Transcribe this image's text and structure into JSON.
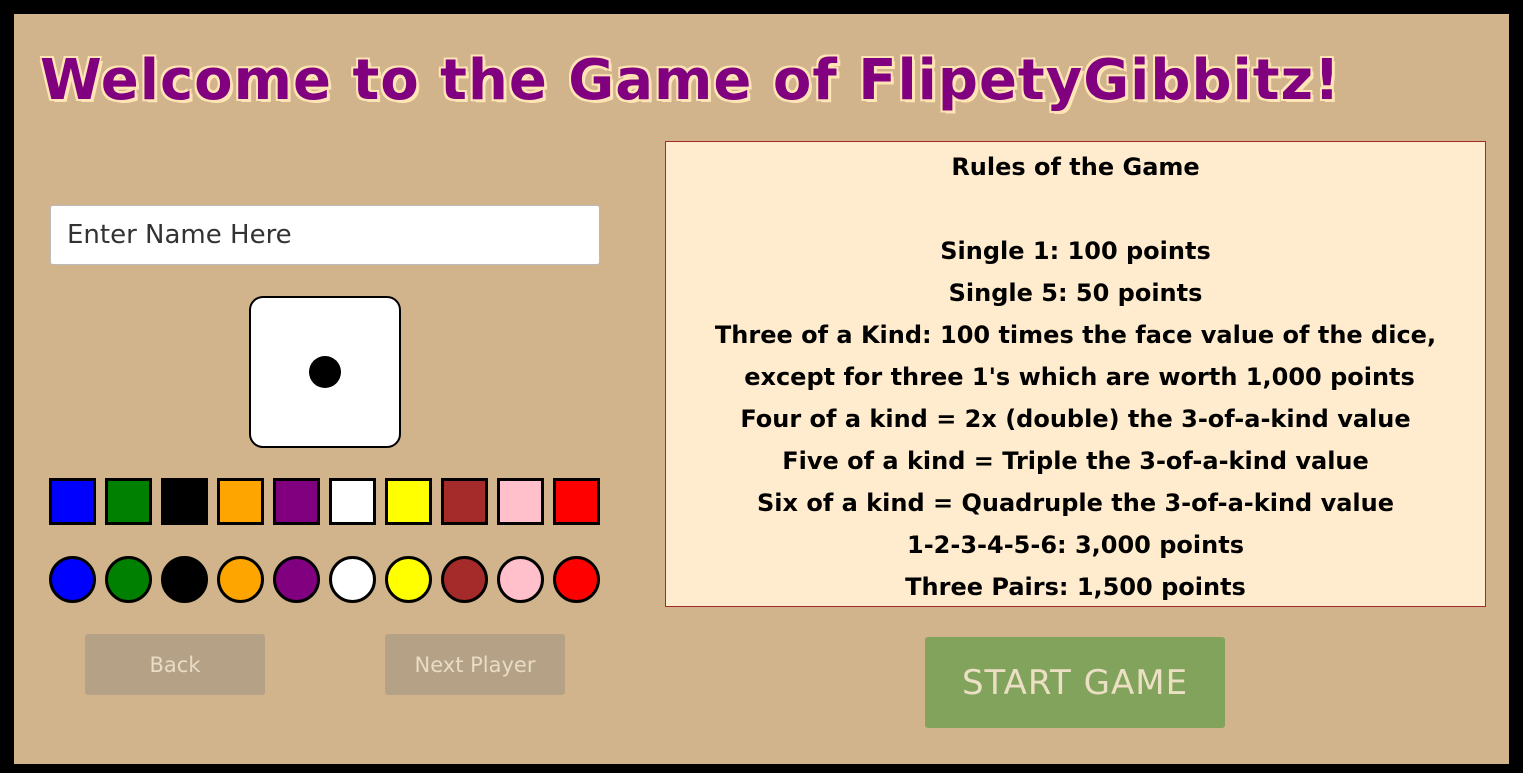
{
  "title": "Welcome to the Game of FlipetyGibbitz!",
  "name_input": {
    "placeholder": "Enter Name Here",
    "value": ""
  },
  "die": {
    "face_value": 1,
    "face_color": "#ffffff",
    "pip_color": "#000000"
  },
  "color_options": {
    "squares": [
      {
        "name": "blue",
        "hex": "#0000ff"
      },
      {
        "name": "green",
        "hex": "#008000"
      },
      {
        "name": "black",
        "hex": "#000000"
      },
      {
        "name": "orange",
        "hex": "#ffa500"
      },
      {
        "name": "purple",
        "hex": "#800080"
      },
      {
        "name": "white",
        "hex": "#ffffff"
      },
      {
        "name": "yellow",
        "hex": "#ffff00"
      },
      {
        "name": "brown",
        "hex": "#a52a2a"
      },
      {
        "name": "pink",
        "hex": "#ffc0cb"
      },
      {
        "name": "red",
        "hex": "#ff0000"
      }
    ],
    "circles": [
      {
        "name": "blue",
        "hex": "#0000ff"
      },
      {
        "name": "green",
        "hex": "#008000"
      },
      {
        "name": "black",
        "hex": "#000000"
      },
      {
        "name": "orange",
        "hex": "#ffa500"
      },
      {
        "name": "purple",
        "hex": "#800080"
      },
      {
        "name": "white",
        "hex": "#ffffff"
      },
      {
        "name": "yellow",
        "hex": "#ffff00"
      },
      {
        "name": "brown",
        "hex": "#a52a2a"
      },
      {
        "name": "pink",
        "hex": "#ffc0cb"
      },
      {
        "name": "red",
        "hex": "#ff0000"
      }
    ]
  },
  "buttons": {
    "back_label": "Back",
    "next_label": "Next Player",
    "start_label": "START GAME"
  },
  "rules": {
    "title": "Rules of the Game",
    "lines": [
      "Single 1: 100 points",
      "Single 5: 50 points",
      "Three of a Kind: 100 times the face value of the dice,",
      "except for three 1's which are worth 1,000 points",
      "Four of a kind = 2x (double) the 3-of-a-kind value",
      "Five of a kind = Triple the 3-of-a-kind value",
      "Six of a kind = Quadruple the 3-of-a-kind value",
      "1-2-3-4-5-6: 3,000 points",
      "Three Pairs: 1,500 points"
    ]
  },
  "colors": {
    "background": "#d2b48c",
    "title": "#800080",
    "title_outline": "#ffe4b5",
    "rules_panel": "#ffebcd",
    "rules_border": "#a52a2a",
    "start_button": "#82a35c",
    "disabled_button": "#b5a185"
  }
}
